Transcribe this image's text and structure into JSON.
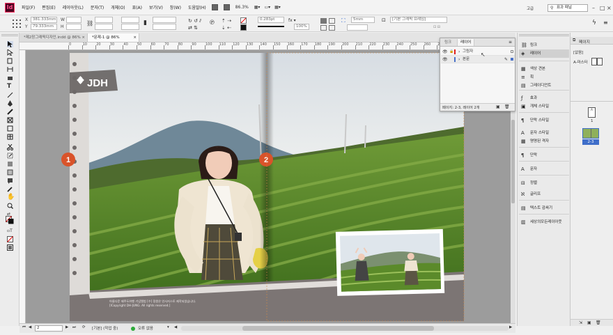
{
  "app": {
    "logo_text": "Id",
    "menu": [
      "파일(F)",
      "편집(E)",
      "레이아웃(L)",
      "문자(T)",
      "개체(O)",
      "표(A)",
      "보기(V)",
      "창(W)",
      "도움말(H)"
    ],
    "zoom": "86.3%",
    "workspace": "고급",
    "search_label": "표과 패널"
  },
  "control": {
    "x_label": "X",
    "x_value": "381.333mm",
    "y_label": "Y",
    "y_value": "79.333mm",
    "w_label": "W",
    "h_label": "H",
    "stroke_weight": "0.283pt",
    "opacity": "100%",
    "gap": "5mm",
    "frame_style": "[기본 그래픽 프레임]"
  },
  "tabs": [
    "*제2장그래픽디자인.indd @ 86%",
    "*문제-1 @ 86%"
  ],
  "ruler_ticks": [
    "0",
    "10",
    "20",
    "30",
    "40",
    "50",
    "60",
    "70",
    "80",
    "90",
    "100",
    "110",
    "120",
    "130",
    "140",
    "150",
    "160",
    "170",
    "180",
    "190",
    "200",
    "210",
    "220",
    "230",
    "240",
    "250",
    "260",
    "270",
    "280"
  ],
  "page_content": {
    "logo": "JDH",
    "badge_1": "1",
    "badge_2": "2",
    "caption_line1": "아름다운 제주도여행 기념앨범 [수] 정원은 인사지스토 제작되었습니다.",
    "caption_line2": "[ICopyright DH-JUNG. All rights reserved.]"
  },
  "layers_panel": {
    "tabs": [
      "링크",
      "레이어"
    ],
    "layers": [
      {
        "name": "그림자",
        "color": "#e02020"
      },
      {
        "name": "본문",
        "color": "#4a72c8"
      }
    ],
    "footer": "페이지: 2-3, 레이어 2개"
  },
  "panel_strip": [
    {
      "label": "링크",
      "icon": "link-icon"
    },
    {
      "label": "레이어",
      "icon": "layers-icon",
      "selected": true
    },
    {
      "label": "색상 견본",
      "icon": "swatches-icon"
    },
    {
      "label": "획",
      "icon": "stroke-icon"
    },
    {
      "label": "그레이디언트",
      "icon": "gradient-icon"
    },
    {
      "label": "효과",
      "icon": "fx-icon"
    },
    {
      "label": "개체 스타일",
      "icon": "object-style-icon"
    },
    {
      "label": "단락 스타일",
      "icon": "paragraph-style-icon"
    },
    {
      "label": "문자 스타일",
      "icon": "character-style-icon"
    },
    {
      "label": "명명된 격자",
      "icon": "named-grid-icon"
    },
    {
      "label": "단락",
      "icon": "paragraph-icon"
    },
    {
      "label": "문자",
      "icon": "character-icon"
    },
    {
      "label": "정렬",
      "icon": "align-icon"
    },
    {
      "label": "글리프",
      "icon": "glyph-icon"
    },
    {
      "label": "텍스트 감싸기",
      "icon": "text-wrap-icon"
    },
    {
      "label": "세상의모든레이아웃",
      "icon": "library-icon"
    }
  ],
  "pages_panel": {
    "title": "페이지",
    "none_label": "[없음]",
    "master_label": "A-마스터",
    "page1_label": "1",
    "spread_label": "2-3"
  },
  "status": {
    "page": "2",
    "master": "[기본] (작업 중)",
    "preflight": "오류 없음"
  }
}
